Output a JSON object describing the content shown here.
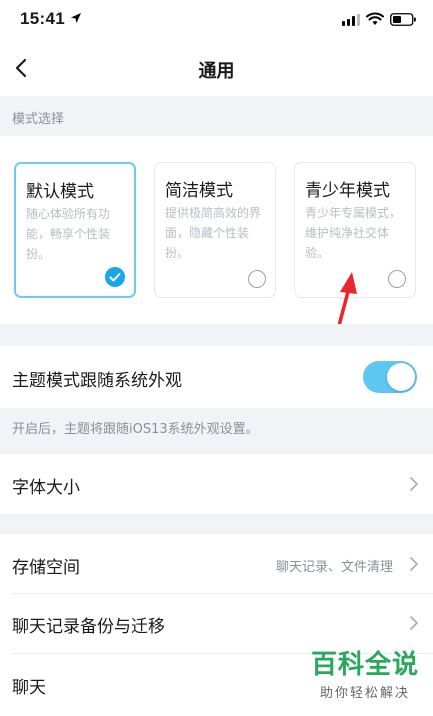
{
  "status_bar": {
    "time": "15:41",
    "icons": [
      "location-arrow-icon",
      "signal-icon",
      "wifi-icon",
      "battery-icon"
    ]
  },
  "nav": {
    "title": "通用",
    "back_icon": "chevron-left-icon"
  },
  "mode_section": {
    "header": "模式选择",
    "modes": [
      {
        "title": "默认模式",
        "desc": "随心体验所有功能，畅享个性装扮。",
        "selected": true
      },
      {
        "title": "简洁模式",
        "desc": "提供极简高效的界面，隐藏个性装扮。",
        "selected": false
      },
      {
        "title": "青少年模式",
        "desc": "青少年专属模式，维护纯净社交体验。",
        "selected": false
      }
    ],
    "accent_color": "#1aa6ea"
  },
  "theme": {
    "label": "主题模式跟随系统外观",
    "toggle_on": true,
    "hint": "开启后，主题将跟随iOS13系统外观设置。"
  },
  "font_size": {
    "label": "字体大小"
  },
  "storage": {
    "label": "存储空间",
    "value": "聊天记录、文件清理"
  },
  "backup": {
    "label": "聊天记录备份与迁移"
  },
  "chat": {
    "label": "聊天"
  },
  "watermark": {
    "title": "百科全说",
    "subtitle": "助你轻松解决"
  }
}
